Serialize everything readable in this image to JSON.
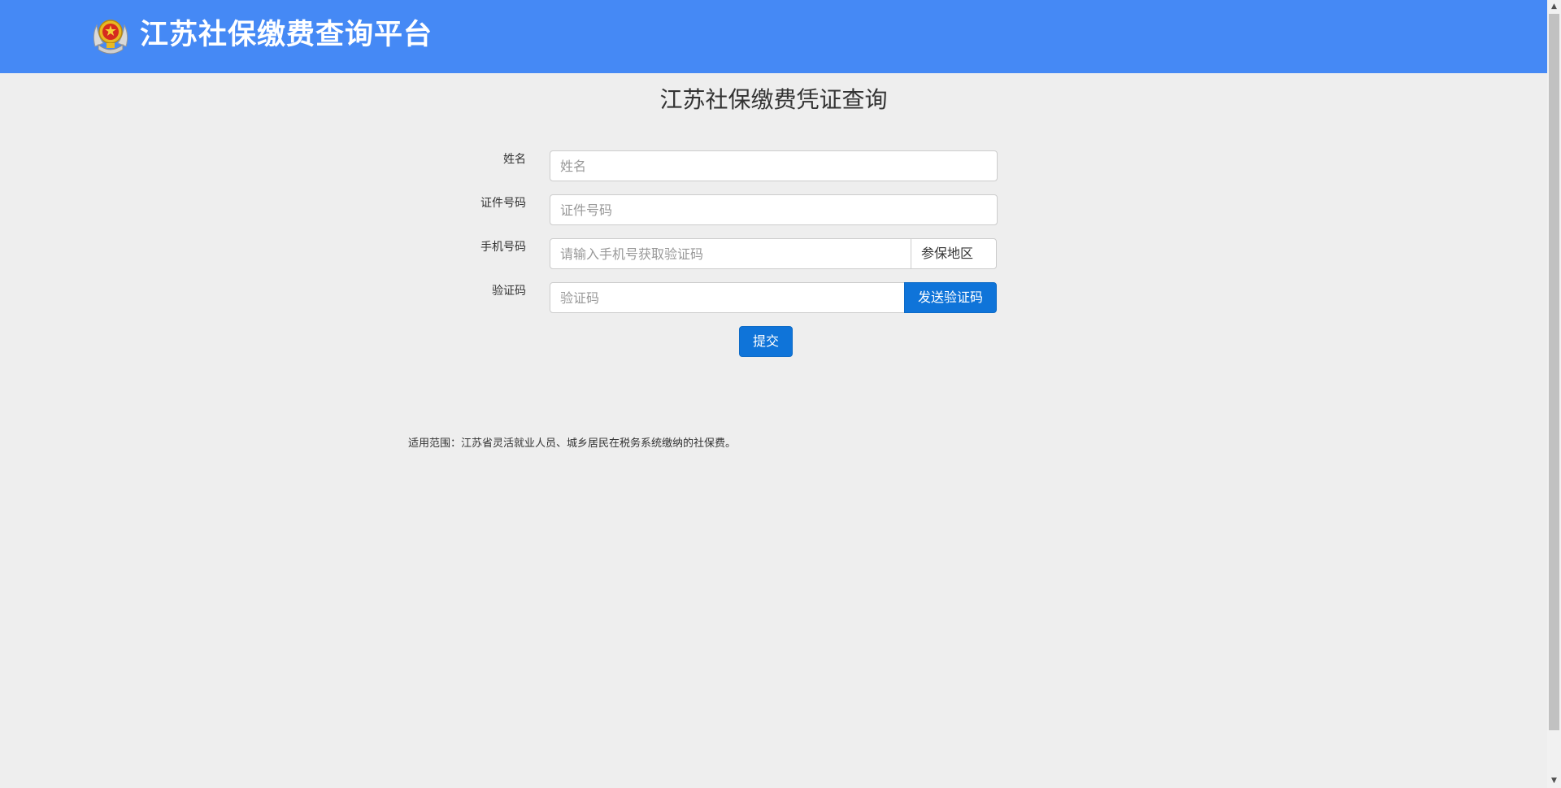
{
  "header": {
    "title": "江苏社保缴费查询平台"
  },
  "page_title": "江苏社保缴费凭证查询",
  "form": {
    "name": {
      "label": "姓名",
      "placeholder": "姓名"
    },
    "id_number": {
      "label": "证件号码",
      "placeholder": "证件号码"
    },
    "phone": {
      "label": "手机号码",
      "placeholder": "请输入手机号获取验证码",
      "region_label": "参保地区"
    },
    "code": {
      "label": "验证码",
      "placeholder": "验证码",
      "send_label": "发送验证码"
    },
    "submit_label": "提交"
  },
  "scope_note": "适用范围：江苏省灵活就业人员、城乡居民在税务系统缴纳的社保费。",
  "colors": {
    "header_bg": "#4589f5",
    "primary_button": "#0f74d9",
    "page_bg": "#eeeeee"
  },
  "icons": {
    "emblem": "tax-emblem-icon",
    "scroll_up": "chevron-up-icon",
    "scroll_down": "chevron-down-icon"
  }
}
